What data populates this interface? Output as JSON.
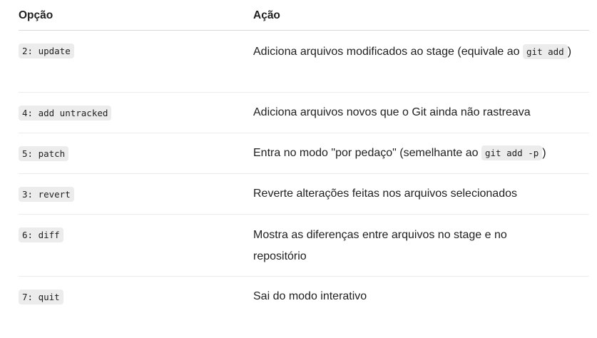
{
  "headers": {
    "option": "Opção",
    "action": "Ação"
  },
  "rows": [
    {
      "option": "2: update",
      "action_text": "Adiciona arquivos modificados ao stage (equivale ao ",
      "action_code": "git add",
      "action_suffix": ")"
    },
    {
      "option": "4: add untracked",
      "action_text": "Adiciona arquivos novos que o Git ainda não rastreava"
    },
    {
      "option": "5: patch",
      "action_text": "Entra no modo \"por pedaço\" (semelhante ao ",
      "action_code": "git add -p",
      "action_suffix": ")"
    },
    {
      "option": "3: revert",
      "action_text": "Reverte alterações feitas nos arquivos selecionados"
    },
    {
      "option": "6: diff",
      "action_text": "Mostra as diferenças entre arquivos no stage e no repositório"
    },
    {
      "option": "7: quit",
      "action_text": "Sai do modo interativo"
    }
  ]
}
